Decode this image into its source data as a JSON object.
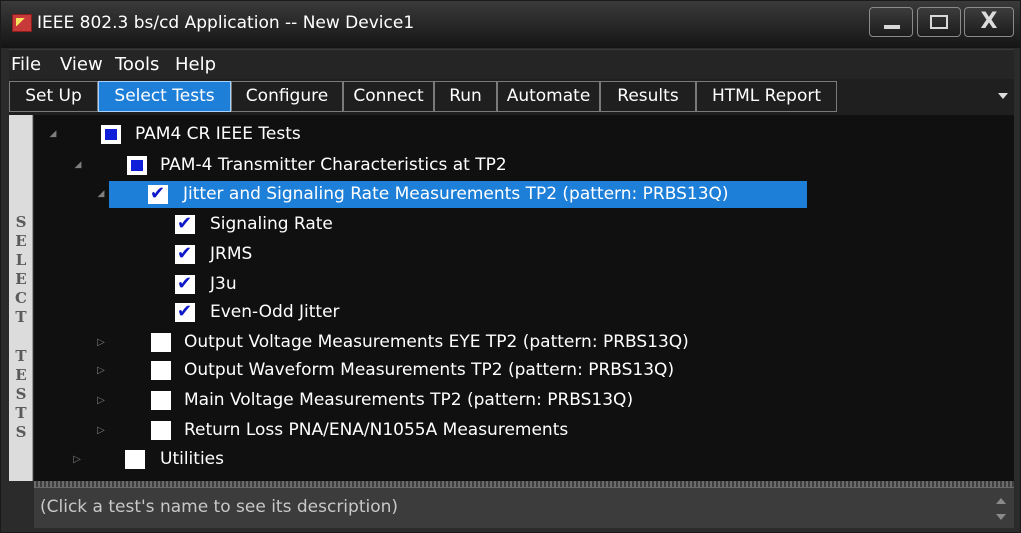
{
  "window": {
    "title": "IEEE 802.3 bs/cd Application -- New Device1",
    "close_glyph": "X"
  },
  "menu": {
    "items": [
      "File",
      "View",
      "Tools",
      "Help"
    ]
  },
  "tabs": [
    {
      "label": "Set Up",
      "active": false
    },
    {
      "label": "Select Tests",
      "active": true
    },
    {
      "label": "Configure",
      "active": false
    },
    {
      "label": "Connect",
      "active": false
    },
    {
      "label": "Run",
      "active": false
    },
    {
      "label": "Automate",
      "active": false
    },
    {
      "label": "Results",
      "active": false
    },
    {
      "label": "HTML Report",
      "active": false
    }
  ],
  "side_label": {
    "word1": [
      "S",
      "E",
      "L",
      "E",
      "C",
      "T"
    ],
    "word2": [
      "T",
      "E",
      "S",
      "T",
      "S"
    ]
  },
  "tree": {
    "root": {
      "label": "PAM4 CR IEEE Tests",
      "state": "partial"
    },
    "group1": {
      "label": "PAM-4 Transmitter Characteristics at TP2",
      "state": "partial"
    },
    "sub1": {
      "label": "Jitter and Signaling Rate Measurements TP2 (pattern: PRBS13Q)",
      "state": "checked",
      "selected": true
    },
    "tests": [
      {
        "label": "Signaling Rate",
        "state": "checked"
      },
      {
        "label": "JRMS",
        "state": "checked"
      },
      {
        "label": "J3u",
        "state": "checked"
      },
      {
        "label": "Even-Odd Jitter",
        "state": "checked"
      }
    ],
    "collapsed": [
      {
        "label": "Output Voltage Measurements EYE TP2 (pattern: PRBS13Q)",
        "state": "unchecked"
      },
      {
        "label": "Output Waveform Measurements TP2 (pattern: PRBS13Q)",
        "state": "unchecked"
      },
      {
        "label": "Main Voltage Measurements TP2 (pattern: PRBS13Q)",
        "state": "unchecked"
      },
      {
        "label": "Return Loss PNA/ENA/N1055A Measurements",
        "state": "unchecked"
      }
    ],
    "utilities": {
      "label": "Utilities",
      "state": "unchecked"
    }
  },
  "description": {
    "text": "(Click a test's name to see its description)"
  },
  "colors": {
    "accent": "#1e7fd8",
    "check": "#0d18c9"
  }
}
